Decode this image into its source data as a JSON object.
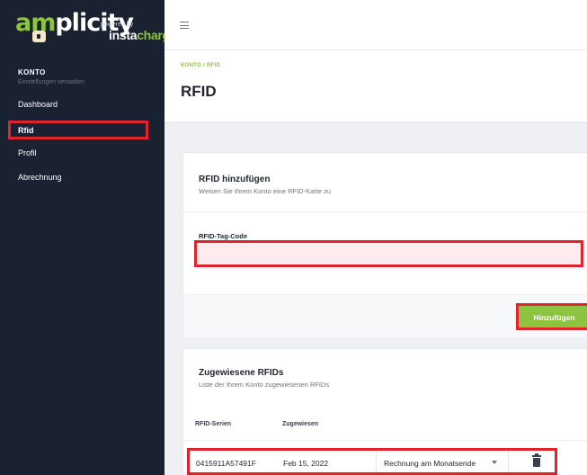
{
  "logo": {
    "word_accent": "am",
    "word_rest": "plicity",
    "powered_by": "powered by",
    "brand_main": "insta",
    "brand_accent": "charge"
  },
  "sidebar": {
    "section_title": "KONTO",
    "section_subtitle": "Einstellungen verwalten",
    "items": [
      {
        "label": "Dashboard"
      },
      {
        "label": "Rfid",
        "active": true
      },
      {
        "label": "Profil"
      },
      {
        "label": "Abrechnung"
      }
    ]
  },
  "header": {
    "breadcrumb": {
      "parent": "KONTO",
      "separator": "/",
      "current": "RFID"
    },
    "title": "RFID"
  },
  "add_card": {
    "title": "RFID hinzufügen",
    "subtitle": "Weisen Sie Ihrem Konto eine RFID-Karte zu",
    "field_label": "RFID-Tag-Code",
    "field_value": "",
    "field_placeholder": "",
    "submit_label": "Hinzufügen"
  },
  "assigned_card": {
    "title": "Zugewiesene RFIDs",
    "subtitle": "Liste der Ihrem Konto zugewiesenen RFIDs",
    "columns": [
      "RFID-Serien",
      "Zugewiesen"
    ],
    "rows": [
      {
        "serial": "0415911A57491F",
        "assigned": "Feb 15, 2022",
        "billing": "Rechnung am Monatsende"
      }
    ]
  },
  "colors": {
    "accent": "#8cc43f",
    "sidebar_bg": "#1a2130",
    "highlight": "#e0242e"
  }
}
